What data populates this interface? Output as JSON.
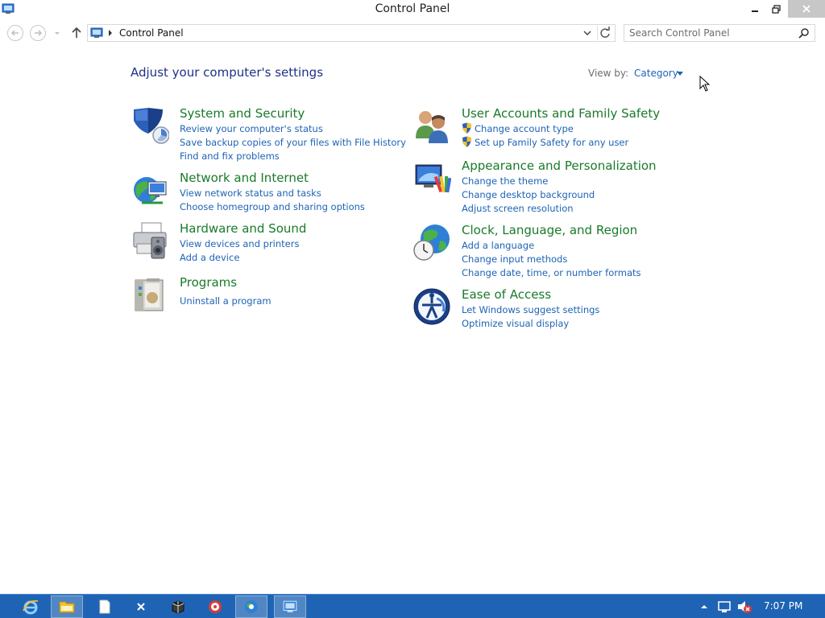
{
  "window": {
    "title": "Control Panel",
    "controls": [
      "minimize-icon",
      "restore-icon",
      "close-icon"
    ]
  },
  "navbar": {
    "address_path": "Control Panel",
    "search_placeholder": "Search Control Panel"
  },
  "main": {
    "heading": "Adjust your computer's settings",
    "view_by_label": "View by:",
    "view_by_value": "Category",
    "left_categories": [
      {
        "title": "System and Security",
        "icon": "shield-icon",
        "links": [
          "Review your computer's status",
          "Save backup copies of your files with File History",
          "Find and fix problems"
        ]
      },
      {
        "title": "Network and Internet",
        "icon": "network-globe-icon",
        "links": [
          "View network status and tasks",
          "Choose homegroup and sharing options"
        ]
      },
      {
        "title": "Hardware and Sound",
        "icon": "printer-speaker-icon",
        "links": [
          "View devices and printers",
          "Add a device"
        ]
      },
      {
        "title": "Programs",
        "icon": "programs-box-icon",
        "links": [
          "Uninstall a program"
        ]
      }
    ],
    "right_categories": [
      {
        "title": "User Accounts and Family Safety",
        "icon": "users-icon",
        "links": [
          "Change account type",
          "Set up Family Safety for any user"
        ]
      },
      {
        "title": "Appearance and Personalization",
        "icon": "monitor-palette-icon",
        "links": [
          "Change the theme",
          "Change desktop background",
          "Adjust screen resolution"
        ]
      },
      {
        "title": "Clock, Language, and Region",
        "icon": "clock-globe-icon",
        "links": [
          "Add a language",
          "Change input methods",
          "Change date, time, or number formats"
        ]
      },
      {
        "title": "Ease of Access",
        "icon": "ease-of-access-icon",
        "links": [
          "Let Windows suggest settings",
          "Optimize visual display"
        ]
      }
    ]
  },
  "taskbar": {
    "items": [
      "internet-explorer-icon",
      "file-explorer-icon",
      "notepad-icon",
      "excel-icon",
      "package-icon",
      "media-icon",
      "browser-icon",
      "control-panel-icon"
    ],
    "clock": "7:07 PM",
    "colors": {
      "taskbar": "#1f64b4",
      "link": "#1e63b5",
      "category_title": "#1a7a2a",
      "heading": "#1e3287"
    }
  }
}
